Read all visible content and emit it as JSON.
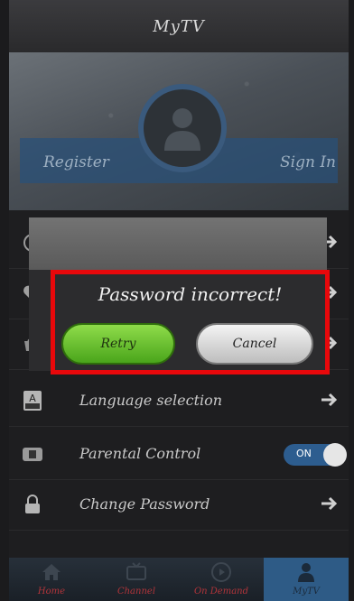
{
  "app": {
    "title": "MyTV"
  },
  "hero": {
    "register_label": "Register",
    "signin_label": "Sign In"
  },
  "menu": {
    "items": [
      {
        "label": "",
        "icon": "clock-icon"
      },
      {
        "label": "",
        "icon": "heart-icon"
      },
      {
        "label": "",
        "icon": "basket-icon"
      },
      {
        "label": "Language selection",
        "icon": "language-icon"
      },
      {
        "label": "Parental Control",
        "icon": "lock-icon",
        "toggle": "ON"
      },
      {
        "label": "Change Password",
        "icon": "padlock-icon"
      }
    ]
  },
  "dialog": {
    "message": "Password incorrect!",
    "retry_label": "Retry",
    "cancel_label": "Cancel"
  },
  "tabs": [
    {
      "label": "Home",
      "icon": "home-icon"
    },
    {
      "label": "Channel",
      "icon": "tv-icon"
    },
    {
      "label": "On Demand",
      "icon": "play-icon"
    },
    {
      "label": "MyTV",
      "icon": "user-icon"
    }
  ],
  "colors": {
    "accent": "#2e5b86",
    "highlight": "#e8080b",
    "retry": "#6cc232"
  }
}
